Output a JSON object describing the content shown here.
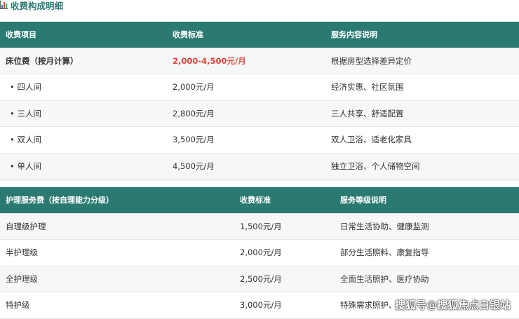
{
  "title": "收费构成明细",
  "bed": {
    "headers": [
      "收费项目",
      "收费标准",
      "服务内容说明"
    ],
    "rows": [
      {
        "item": "床位费（按月计算）",
        "price": "2,000-4,500元/月",
        "desc": "根据房型选择差异定价"
      },
      {
        "item": "• 四人间",
        "price": "2,000元/月",
        "desc": "经济实惠、社区氛围"
      },
      {
        "item": "• 三人间",
        "price": "2,800元/月",
        "desc": "三人共享、舒适配置"
      },
      {
        "item": "• 双人间",
        "price": "3,500元/月",
        "desc": "双人卫浴、适老化家具"
      },
      {
        "item": "• 单人间",
        "price": "4,500元/月",
        "desc": "独立卫浴、个人储物空间"
      }
    ]
  },
  "care": {
    "headers": [
      "护理服务费（按自理能力分级）",
      "收费标准",
      "服务等级说明"
    ],
    "rows": [
      {
        "item": "自理级护理",
        "price": "1,500元/月",
        "desc": "日常生活协助、健康监测"
      },
      {
        "item": "半护理级",
        "price": "2,000元/月",
        "desc": "部分生活照料、康复指导"
      },
      {
        "item": "全护理级",
        "price": "2,500元/月",
        "desc": "全面生活照护、医疗协助"
      },
      {
        "item": "特护级",
        "price": "3,000元/月",
        "desc": "特殊需求照护、"
      }
    ]
  },
  "watermark": "搜狐号@搜狐焦点白银站"
}
